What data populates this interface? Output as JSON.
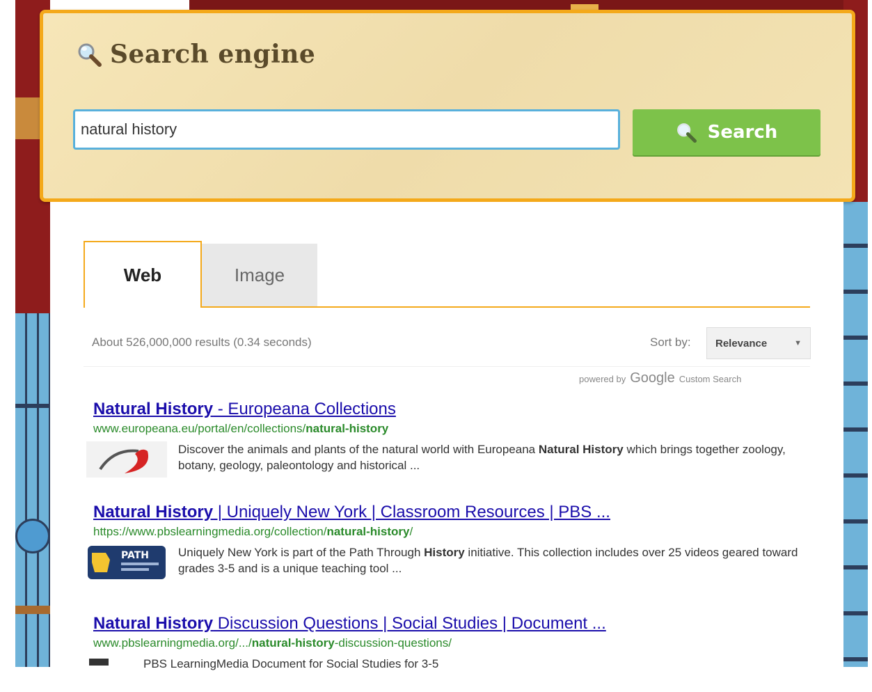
{
  "panel": {
    "title": "Search engine",
    "query": "natural history",
    "search_label": "Search"
  },
  "tabs": [
    {
      "label": "Web"
    },
    {
      "label": "Image"
    }
  ],
  "results_meta": {
    "count_text": "About 526,000,000 results (0.34 seconds)",
    "sort_label": "Sort by:",
    "sort_value": "Relevance",
    "powered_prefix": "powered by",
    "powered_brand": "Google",
    "powered_suffix": "Custom Search"
  },
  "results": [
    {
      "title_bold": "Natural History",
      "title_rest": " - Europeana Collections",
      "url_prefix": "www.europeana.eu/portal/en/collections/",
      "url_bold": "natural-history",
      "url_suffix": "",
      "snippet_a": "Discover the animals and plants of the natural world with Europeana ",
      "snippet_bold": "Natural History",
      "snippet_b": " which brings together zoology, botany, geology, paleontology and historical ..."
    },
    {
      "title_bold": "Natural History",
      "title_rest": " | Uniquely New York | Classroom Resources | PBS ...",
      "url_prefix": "https://www.pbslearningmedia.org/collection/",
      "url_bold": "natural-history",
      "url_suffix": "/",
      "snippet_a": "Uniquely New York is part of the Path Through ",
      "snippet_bold": "History",
      "snippet_b": " initiative. This collection includes over 25 videos geared toward grades 3-5 and is a unique teaching tool ..."
    },
    {
      "title_bold": "Natural History",
      "title_rest": " Discussion Questions | Social Studies | Document ...",
      "url_prefix": "www.pbslearningmedia.org/.../",
      "url_bold": "natural-history",
      "url_suffix": "-discussion-questions/",
      "snippet_a": "PBS LearningMedia Document for Social Studies for 3-5",
      "snippet_bold": "",
      "snippet_b": ""
    }
  ],
  "thumbs": [
    {
      "brand": ""
    },
    {
      "brand": "PATH"
    }
  ],
  "colors": {
    "panel_border": "#f4a91a",
    "search_button": "#7dc24a",
    "link": "#1a0dab",
    "url": "#2a8a2a"
  }
}
